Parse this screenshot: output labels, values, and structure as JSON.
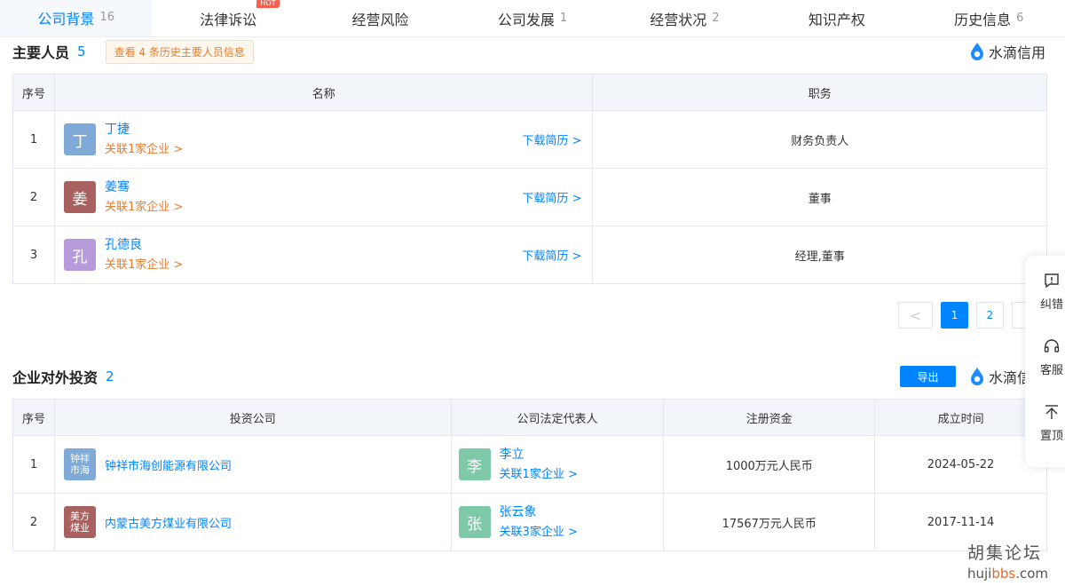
{
  "tabs": [
    {
      "label": "公司背景",
      "count": "16"
    },
    {
      "label": "法律诉讼",
      "count": "",
      "badge": "HOT"
    },
    {
      "label": "经营风险",
      "count": ""
    },
    {
      "label": "公司发展",
      "count": "1"
    },
    {
      "label": "经营状况",
      "count": "2"
    },
    {
      "label": "知识产权",
      "count": ""
    },
    {
      "label": "历史信息",
      "count": "6"
    }
  ],
  "personnel": {
    "title": "主要人员",
    "count": "5",
    "history_prefix": "查看",
    "history_num": "4",
    "history_suffix": "条历史主要人员信息",
    "brand": "水滴信用",
    "headers": {
      "no": "序号",
      "name": "名称",
      "role": "职务"
    },
    "rows": [
      {
        "no": "1",
        "avatar": "丁",
        "avatar_color": "#7fa9d6",
        "name": "丁捷",
        "rel": "关联1家企业 >",
        "download": "下载简历 >",
        "role": "财务负责人"
      },
      {
        "no": "2",
        "avatar": "姜",
        "avatar_color": "#a8615e",
        "name": "姜骞",
        "rel": "关联1家企业 >",
        "download": "下载简历 >",
        "role": "董事"
      },
      {
        "no": "3",
        "avatar": "孔",
        "avatar_color": "#b69ad9",
        "name": "孔德良",
        "rel": "关联1家企业 >",
        "download": "下载简历 >",
        "role": "经理,董事"
      }
    ]
  },
  "pagination": {
    "prev": "<",
    "pages": [
      "1",
      "2"
    ],
    "current": "1"
  },
  "investment": {
    "title": "企业对外投资",
    "count": "2",
    "export": "导出",
    "brand": "水滴信",
    "headers": {
      "no": "序号",
      "company": "投资公司",
      "rep": "公司法定代表人",
      "capital": "注册资金",
      "date": "成立时间"
    },
    "rows": [
      {
        "no": "1",
        "logo": "钟祥市海",
        "logo_color": "#7fa9d6",
        "company": "钟祥市海创能源有限公司",
        "rep_avatar": "李",
        "rep_color": "#7ec9a8",
        "rep": "李立",
        "rep_rel": "关联1家企业 >",
        "capital": "1000万元人民币",
        "date": "2024-05-22"
      },
      {
        "no": "2",
        "logo": "美方煤业",
        "logo_color": "#a8615e",
        "company": "内蒙古美方煤业有限公司",
        "rep_avatar": "张",
        "rep_color": "#7ec9a8",
        "rep": "张云象",
        "rep_rel": "关联3家企业 >",
        "capital": "17567万元人民币",
        "date": "2017-11-14"
      }
    ]
  },
  "float_toolbar": [
    {
      "label": "纠错",
      "icon": "feedback-icon"
    },
    {
      "label": "客服",
      "icon": "headset-icon"
    },
    {
      "label": "置顶",
      "icon": "to-top-icon"
    }
  ],
  "watermark": {
    "line1": "胡集论坛",
    "line2_a": "huji",
    "line2_b": "bbs",
    "line2_c": ".com"
  },
  "colors": {
    "accent": "#0084ff",
    "orange": "#e87b2d"
  }
}
